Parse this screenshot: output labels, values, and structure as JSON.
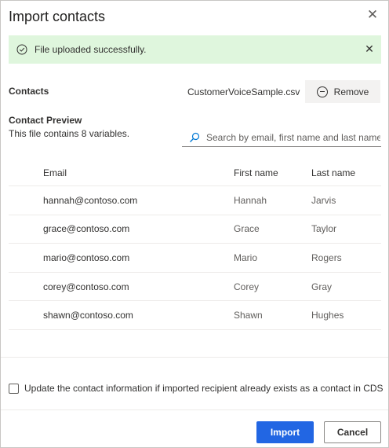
{
  "dialog": {
    "title": "Import contacts",
    "close_icon": "close-icon"
  },
  "banner": {
    "message": "File uploaded successfully.",
    "status_icon": "success-check-icon",
    "background": "#dff6dd",
    "dismiss_icon": "close-icon"
  },
  "contacts": {
    "label": "Contacts",
    "file_name": "CustomerVoiceSample.csv",
    "remove_label": "Remove",
    "remove_icon": "remove-circle-icon"
  },
  "preview": {
    "label": "Contact Preview",
    "subtitle": "This file contains 8 variables.",
    "search_placeholder": "Search by email, first name and last name",
    "search_icon": "search-icon"
  },
  "table": {
    "headers": [
      "Email",
      "First name",
      "Last name"
    ],
    "rows": [
      [
        "hannah@contoso.com",
        "Hannah",
        "Jarvis"
      ],
      [
        "grace@contoso.com",
        "Grace",
        "Taylor"
      ],
      [
        "mario@contoso.com",
        "Mario",
        "Rogers"
      ],
      [
        "corey@contoso.com",
        "Corey",
        "Gray"
      ],
      [
        "shawn@contoso.com",
        "Shawn",
        "Hughes"
      ]
    ]
  },
  "update": {
    "checked": false,
    "label": "Update the contact information if imported recipient already exists as a contact in CDS"
  },
  "footer": {
    "import_label": "Import",
    "cancel_label": "Cancel",
    "primary_color": "#2266e3"
  }
}
